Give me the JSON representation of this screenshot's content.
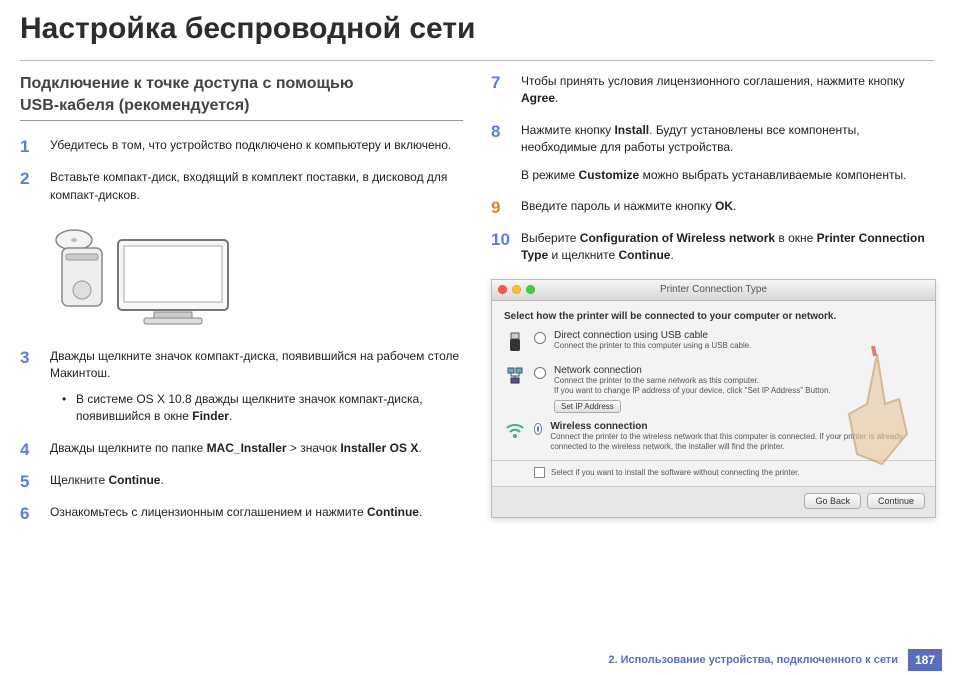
{
  "title": "Настройка беспроводной сети",
  "left": {
    "subhead_l1": "Подключение к точке доступа с помощью",
    "subhead_l2": "USB-кабеля (рекомендуется)",
    "steps": {
      "s1": "Убедитесь в том, что устройство подключено к компьютеру и включено.",
      "s2": "Вставьте компакт-диск, входящий в комплект поставки, в дисковод для компакт-дисков.",
      "s3_a": "Дважды щелкните значок компакт-диска, появившийся на рабочем столе Макинтош.",
      "s3_bullet_pre": "В системе OS X 10.8 дважды щелкните значок компакт-диска, появившийся в окне ",
      "s3_bullet_bold": "Finder",
      "s3_bullet_post": ".",
      "s4_pre": "Дважды щелкните по папке ",
      "s4_b1": "MAC_Installer",
      "s4_mid": " > значок ",
      "s4_b2": "Installer OS X",
      "s4_post": ".",
      "s5_pre": "Щелкните ",
      "s5_bold": "Continue",
      "s5_post": ".",
      "s6_pre": "Ознакомьтесь с лицензионным соглашением и нажмите ",
      "s6_bold": "Continue",
      "s6_post": "."
    }
  },
  "right": {
    "steps": {
      "s7_pre": "Чтобы принять условия лицензионного соглашения, нажмите кнопку ",
      "s7_bold": "Agree",
      "s7_post": ".",
      "s8_pre": "Нажмите кнопку ",
      "s8_bold": "Install",
      "s8_post": ". Будут установлены все компоненты, необходимые для работы устройства.",
      "s8_extra_pre": "В режиме ",
      "s8_extra_bold": "Customize",
      "s8_extra_post": " можно выбрать устанавливаемые компоненты.",
      "s9_pre": "Введите пароль и нажмите кнопку ",
      "s9_bold": "OK",
      "s9_post": ".",
      "s10_pre": "Выберите ",
      "s10_b1": "Configuration of Wireless network",
      "s10_mid": " в окне ",
      "s10_b2": "Printer Connection Type",
      "s10_post1": " и щелкните ",
      "s10_b3": "Continue",
      "s10_post2": "."
    }
  },
  "dialog": {
    "window_title": "Printer Connection Type",
    "hint": "Select how the printer will be connected to your computer or network.",
    "opt1_label": "Direct connection using USB cable",
    "opt1_desc": "Connect the printer to this computer using a USB cable.",
    "opt2_label": "Network connection",
    "opt2_desc": "Connect the printer to the same network as this computer.\nIf you want to change IP address of your device, click \"Set IP Address\" Button.",
    "ip_btn": "Set IP Address",
    "opt3_label": "Wireless connection",
    "opt3_desc": "Connect the printer to the wireless network that this computer is connected.\nIf your printer is already connected to the wireless network, the installer will find the printer.",
    "chk_label": "Select if you want to install the software without connecting the printer.",
    "btn_back": "Go Back",
    "btn_continue": "Continue"
  },
  "footer": {
    "section": "2.  Использование устройства, подключенного к сети",
    "page": "187"
  }
}
